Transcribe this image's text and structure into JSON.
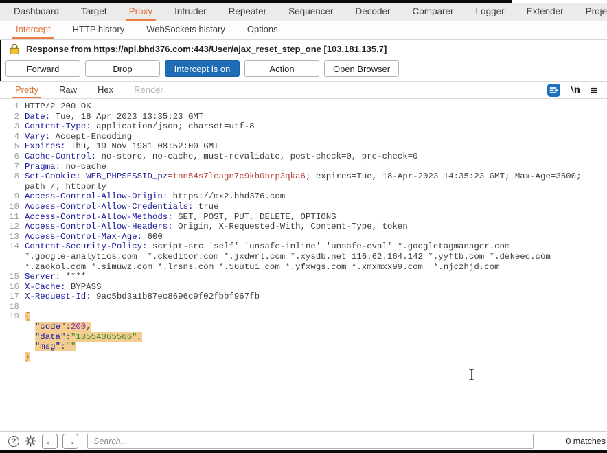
{
  "colors": {
    "accent_orange": "#e0703a",
    "intercept_blue": "#1e6cb5",
    "selection_highlight": "#f6cd90",
    "header_name_blue": "#1b1b9e",
    "cookie_value_red": "#bb4036",
    "json_string_green": "#2f8f2f",
    "json_number_purple": "#8f33a8"
  },
  "tabs_main": [
    {
      "label": "Dashboard"
    },
    {
      "label": "Target"
    },
    {
      "label": "Proxy",
      "active": true
    },
    {
      "label": "Intruder"
    },
    {
      "label": "Repeater"
    },
    {
      "label": "Sequencer"
    },
    {
      "label": "Decoder"
    },
    {
      "label": "Comparer"
    },
    {
      "label": "Logger"
    },
    {
      "label": "Extender"
    },
    {
      "label": "Project options"
    }
  ],
  "tabs_sub": [
    {
      "label": "Intercept",
      "active": true
    },
    {
      "label": "HTTP history"
    },
    {
      "label": "WebSockets history"
    },
    {
      "label": "Options"
    }
  ],
  "banner": {
    "message": "Response from https://api.bhd376.com:443/User/ajax_reset_step_one  [103.181.135.7]"
  },
  "toolbar": {
    "forward": "Forward",
    "drop": "Drop",
    "intercept": "Intercept is on",
    "action": "Action",
    "open_browser": "Open Browser"
  },
  "editor_tabs": [
    {
      "label": "Pretty",
      "active": true
    },
    {
      "label": "Raw"
    },
    {
      "label": "Hex"
    },
    {
      "label": "Render",
      "disabled": true
    }
  ],
  "icons": {
    "newline_label": "\\n",
    "menu": "≡",
    "help": "?",
    "back_arrow": "←",
    "forward_arrow": "→"
  },
  "editor": {
    "lines": [
      {
        "num": "1",
        "segs": [
          [
            "val",
            "HTTP/2 200 OK"
          ]
        ]
      },
      {
        "num": "2",
        "segs": [
          [
            "name",
            "Date:"
          ],
          [
            "val",
            " Tue, 18 Apr 2023 13:35:23 GMT"
          ]
        ]
      },
      {
        "num": "3",
        "segs": [
          [
            "name",
            "Content-Type:"
          ],
          [
            "val",
            " application/json; charset=utf-8"
          ]
        ]
      },
      {
        "num": "4",
        "segs": [
          [
            "name",
            "Vary:"
          ],
          [
            "val",
            " Accept-Encoding"
          ]
        ]
      },
      {
        "num": "5",
        "segs": [
          [
            "name",
            "Expires:"
          ],
          [
            "val",
            " Thu, 19 Nov 1981 08:52:00 GMT"
          ]
        ]
      },
      {
        "num": "6",
        "segs": [
          [
            "name",
            "Cache-Control:"
          ],
          [
            "val",
            " no-store, no-cache, must-revalidate, post-check=0, pre-check=0"
          ]
        ]
      },
      {
        "num": "7",
        "segs": [
          [
            "name",
            "Pragma:"
          ],
          [
            "val",
            " no-cache"
          ]
        ]
      },
      {
        "num": "8",
        "segs": [
          [
            "name",
            "Set-Cookie:"
          ],
          [
            "val",
            " "
          ],
          [
            "name",
            "WEB_PHPSESSID_pz"
          ],
          [
            "red",
            "=tnn54s7lcagn7c9kb0nrp3qka6"
          ],
          [
            "val",
            "; expires=Tue, 18-Apr-2023 14:35:23 GMT; Max-Age=3600;"
          ]
        ]
      },
      {
        "num": "",
        "segs": [
          [
            "val",
            "path=/; httponly"
          ]
        ]
      },
      {
        "num": "9",
        "segs": [
          [
            "name",
            "Access-Control-Allow-Origin:"
          ],
          [
            "val",
            " https://mx2.bhd376.com"
          ]
        ]
      },
      {
        "num": "10",
        "segs": [
          [
            "name",
            "Access-Control-Allow-Credentials:"
          ],
          [
            "val",
            " true"
          ]
        ]
      },
      {
        "num": "11",
        "segs": [
          [
            "name",
            "Access-Control-Allow-Methods:"
          ],
          [
            "val",
            " GET, POST, PUT, DELETE, OPTIONS"
          ]
        ]
      },
      {
        "num": "12",
        "segs": [
          [
            "name",
            "Access-Control-Allow-Headers:"
          ],
          [
            "val",
            " Origin, X-Requested-With, Content-Type, token"
          ]
        ]
      },
      {
        "num": "13",
        "segs": [
          [
            "name",
            "Access-Control-Max-Age:"
          ],
          [
            "val",
            " 600"
          ]
        ]
      },
      {
        "num": "14",
        "segs": [
          [
            "name",
            "Content-Security-Policy:"
          ],
          [
            "val",
            " script-src 'self' 'unsafe-inline' 'unsafe-eval' *.googletagmanager.com"
          ]
        ]
      },
      {
        "num": "",
        "segs": [
          [
            "val",
            "*.google-analytics.com  *.ckeditor.com *.jxdwrl.com *.xysdb.net 116.62.164.142 *.yyftb.com *.dekeec.com"
          ]
        ]
      },
      {
        "num": "",
        "segs": [
          [
            "val",
            "*.zaokol.com *.simuwz.com *.lrsns.com *.56utui.com *.yfxwgs.com *.xmxmxx99.com  *.njczhjd.com"
          ]
        ]
      },
      {
        "num": "15",
        "segs": [
          [
            "name",
            "Server:"
          ],
          [
            "val",
            " ****"
          ]
        ]
      },
      {
        "num": "16",
        "segs": [
          [
            "name",
            "X-Cache:"
          ],
          [
            "val",
            " BYPASS"
          ]
        ]
      },
      {
        "num": "17",
        "segs": [
          [
            "name",
            "X-Request-Id:"
          ],
          [
            "val",
            " 9ac5bd3a1b87ec8696c9f02fbbf967fb"
          ]
        ]
      },
      {
        "num": "18",
        "segs": []
      },
      {
        "num": "19",
        "hl": true,
        "segs": [
          [
            "brace",
            "{"
          ]
        ]
      },
      {
        "num": "",
        "indent": 2,
        "hl": true,
        "segs": [
          [
            "key",
            "\"code\""
          ],
          [
            "punct",
            ":"
          ],
          [
            "num2",
            "200"
          ],
          [
            "punct",
            ","
          ]
        ]
      },
      {
        "num": "",
        "indent": 2,
        "hl": true,
        "segs": [
          [
            "key",
            "\"data\""
          ],
          [
            "punct",
            ":"
          ],
          [
            "str",
            "\"13554365566\""
          ],
          [
            "punct",
            ","
          ]
        ]
      },
      {
        "num": "",
        "indent": 2,
        "hl": true,
        "segs": [
          [
            "key",
            "\"msg\""
          ],
          [
            "punct",
            ":"
          ],
          [
            "str",
            "\"\""
          ]
        ]
      },
      {
        "num": "",
        "hl": true,
        "segs": [
          [
            "brace",
            "}"
          ]
        ]
      }
    ]
  },
  "statusbar": {
    "search_placeholder": "Search...",
    "matches": "0 matches"
  }
}
